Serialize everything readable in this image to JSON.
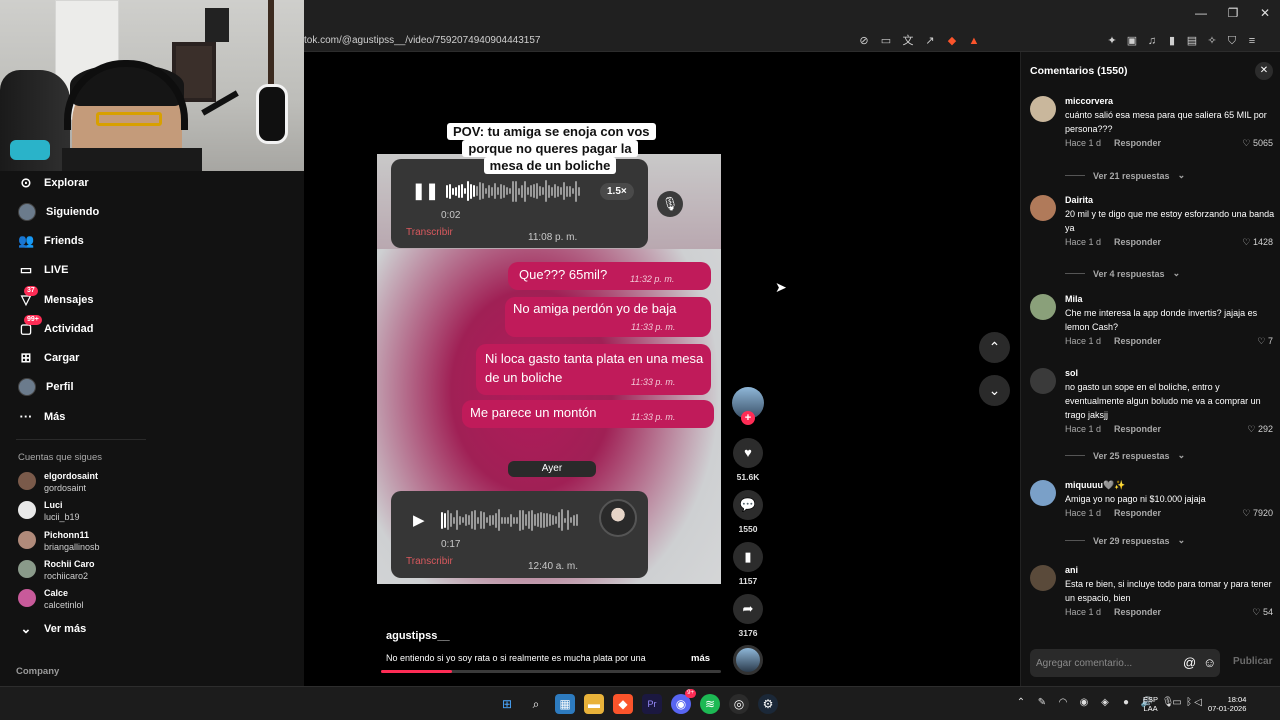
{
  "browser": {
    "url": "tok.com/@agustipss__/video/7592074940904443157",
    "address_icons": [
      "no-translate-icon",
      "cast-icon",
      "translate-icon",
      "share-icon",
      "brave-shields-icon",
      "brave-rewards-icon"
    ],
    "extension_icons": [
      "extensions-icon",
      "screenshot-icon",
      "media-icon",
      "sidebar-icon",
      "wallet-icon",
      "leo-icon",
      "vpn-icon",
      "menu-icon"
    ]
  },
  "sidebar": {
    "nav": [
      {
        "label": "Explorar",
        "icon": "compass-icon"
      },
      {
        "label": "Siguiendo",
        "icon": "following-avatar-icon"
      },
      {
        "label": "Friends",
        "icon": "friends-icon"
      },
      {
        "label": "LIVE",
        "icon": "live-icon"
      },
      {
        "label": "Mensajes",
        "icon": "messages-icon",
        "badge": "37"
      },
      {
        "label": "Actividad",
        "icon": "activity-icon",
        "badge": "99+"
      },
      {
        "label": "Cargar",
        "icon": "upload-icon"
      },
      {
        "label": "Perfil",
        "icon": "profile-avatar-icon"
      },
      {
        "label": "Más",
        "icon": "more-icon"
      }
    ],
    "following_title": "Cuentas que sigues",
    "following": [
      {
        "name": "elgordosaint",
        "handle": "gordosaint",
        "color": "#7a5a4a"
      },
      {
        "name": "Luci",
        "handle": "lucii_b19",
        "color": "#e8e8e8"
      },
      {
        "name": "Pichonn11",
        "handle": "briangallinosb",
        "color": "#b08a7a"
      },
      {
        "name": "Rochii Caro",
        "handle": "rochiicaro2",
        "color": "#8a9a8a"
      },
      {
        "name": "Calce",
        "handle": "calcetinlol",
        "color": "#c85a9a"
      }
    ],
    "see_more": "Ver más",
    "company": "Company"
  },
  "video": {
    "pov_text": "POV: tu amiga se enoja con vos porque no queres pagar la mesa de un boliche",
    "voice1": {
      "duration": "0:02",
      "speed": "1.5×",
      "transcribe": "Transcribir",
      "time": "11:08 p. m."
    },
    "messages": [
      {
        "text": "Que??? 65mil?",
        "time": "11:32 p. m."
      },
      {
        "text": "No amiga perdón yo de baja",
        "time": "11:33 p. m."
      },
      {
        "text": "Ni loca gasto tanta plata en una mesa de un boliche",
        "time": "11:33 p. m."
      },
      {
        "text": "Me parece un montón",
        "time": "11:33 p. m."
      }
    ],
    "day_separator": "Ayer",
    "voice2": {
      "duration": "0:17",
      "transcribe": "Transcribir",
      "time": "12:40 a. m."
    },
    "creator": "agustipss__",
    "caption": "No entiendo si yo soy rata o si realmente es mucha plata por una",
    "more": "más",
    "progress": 0.21
  },
  "actions": {
    "likes": "51.6K",
    "comments": "1550",
    "saves": "1157",
    "shares": "3176"
  },
  "comments_panel": {
    "title": "Comentarios (1550)",
    "reply_label": "Responder",
    "items": [
      {
        "user": "miccorvera",
        "text": "cuánto salió esa mesa para que saliera 65 MIL por persona???",
        "time": "Hace 1 d",
        "likes": "5065",
        "replies": "Ver 21 respuestas",
        "color": "#c9b79c"
      },
      {
        "user": "Dairita",
        "text": "20 mil y te digo que me estoy esforzando una banda ya",
        "time": "Hace 1 d",
        "likes": "1428",
        "replies": "Ver 4 respuestas",
        "color": "#b07a5a"
      },
      {
        "user": "Mila",
        "text": "Che me interesa la app donde invertis? jajaja es lemon Cash?",
        "time": "Hace 1 d",
        "likes": "7",
        "replies": "",
        "color": "#8aa07a"
      },
      {
        "user": "sol",
        "text": "no gasto un sope en el boliche, entro y eventualmente algun boludo me va a comprar un trago jaksjj",
        "time": "Hace 1 d",
        "likes": "292",
        "replies": "Ver 25 respuestas",
        "color": "#3a3a3a"
      },
      {
        "user": "miquuuu🩶✨",
        "text": "Amiga yo no pago ni $10.000 jajaja",
        "time": "Hace 1 d",
        "likes": "7920",
        "replies": "Ver 29 respuestas",
        "color": "#7aa0c8"
      },
      {
        "user": "ani",
        "text": "Esta re bien, si incluye todo para tomar y para tener un espacio, bien",
        "time": "Hace 1 d",
        "likes": "54",
        "replies": "",
        "color": "#5a4a3a"
      }
    ],
    "input_placeholder": "Agregar comentario...",
    "post_label": "Publicar"
  },
  "taskbar": {
    "apps": [
      "windows-start-icon",
      "search-icon",
      "widgets-icon",
      "file-explorer-icon",
      "brave-icon",
      "premiere-icon",
      "discord-icon",
      "spotify-icon",
      "obs-icon",
      "steam-icon"
    ],
    "discord_badge": "9+",
    "lang_top": "ESP",
    "lang_bottom": "LAA",
    "time": "18:04",
    "date": "07-01-2026"
  }
}
